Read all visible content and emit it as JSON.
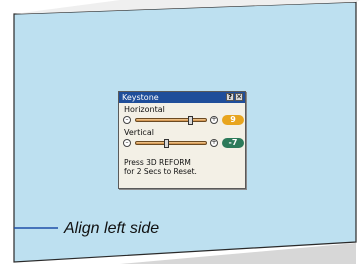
{
  "osd": {
    "title": "Keystone",
    "help_button": "?",
    "close_button": "✕",
    "horizontal": {
      "label": "Horizontal",
      "value": "9",
      "level": 0.78
    },
    "vertical": {
      "label": "Vertical",
      "value": "-7",
      "level": 0.42
    },
    "hint": "Press 3D REFORM\nfor 2 Secs to Reset."
  },
  "caption": "Align left side",
  "colors": {
    "screen_fill": "#bde0f0",
    "horizontal_value_bg": "#e8a51e",
    "vertical_value_bg": "#2c7a5a",
    "title_bar": "#1f4e9a"
  }
}
